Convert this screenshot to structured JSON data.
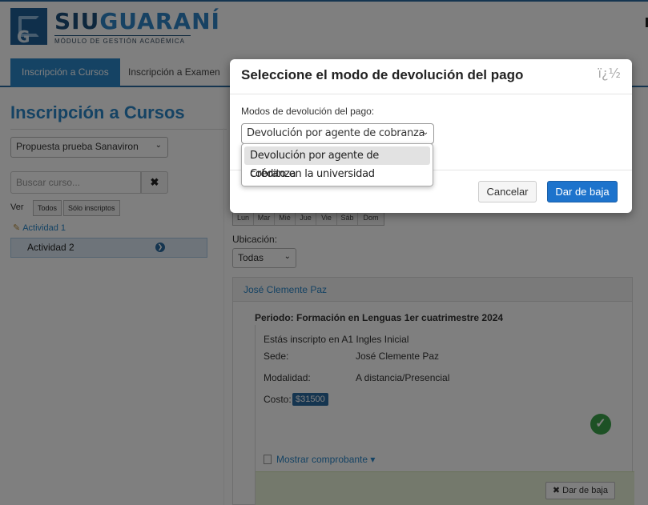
{
  "app": {
    "logo_name_part1": "SIU",
    "logo_name_part2": "GUARANÍ",
    "logo_subtitle": "MÓDULO DE GESTIÓN ACADÉMICA",
    "logo_letter": "G"
  },
  "nav": {
    "tabs": [
      {
        "label": "Inscripción a Cursos",
        "active": true
      },
      {
        "label": "Inscripción a Examen",
        "active": false
      }
    ]
  },
  "sidebar": {
    "title": "Inscripción a Cursos",
    "propuesta": "Propuesta prueba Sanaviron",
    "search_placeholder": "Buscar curso...",
    "clear_icon": "✖",
    "ver_label": "Ver",
    "filter_all": "Todos",
    "filter_inscriptos": "Sólo inscriptos",
    "activities": [
      {
        "label": "Actividad 1"
      },
      {
        "label": "Actividad 2",
        "selected": true
      }
    ]
  },
  "main": {
    "days": [
      "Lun",
      "Mar",
      "Mié",
      "Jue",
      "Vie",
      "Sáb",
      "Dom"
    ],
    "ubicacion_label": "Ubicación:",
    "ubicacion_value": "Todas",
    "sede_header": "José Clemente Paz",
    "periodo": "Periodo: Formación en Lenguas 1er cuatrimestre 2024",
    "inscripto_text": "Estás inscripto en A1 Ingles Inicial",
    "sede_label": "Sede:",
    "sede_value": "José Clemente Paz",
    "modalidad_label": "Modalidad:",
    "modalidad_value": "A distancia/Presencial",
    "costo_label": "Costo:",
    "costo_value": "$31500",
    "mostrar_comprobante": "Mostrar comprobante ▾",
    "dar_de_baja": "Dar de baja",
    "x_icon": "✖"
  },
  "modal": {
    "title": "Seleccione el modo de devolución del pago",
    "close_glyph": "ï¿½",
    "field_label": "Modos de devolución del pago:",
    "selected_value": "Devolución por agente de cobranza",
    "options": [
      "Devolución por agente de cobranza",
      "Crédito en la universidad"
    ],
    "cancel_label": "Cancelar",
    "confirm_label": "Dar de baja"
  },
  "colors": {
    "brand_blue": "#2a86c8",
    "primary_button": "#1d73cc",
    "success_green": "#3aa34a"
  }
}
